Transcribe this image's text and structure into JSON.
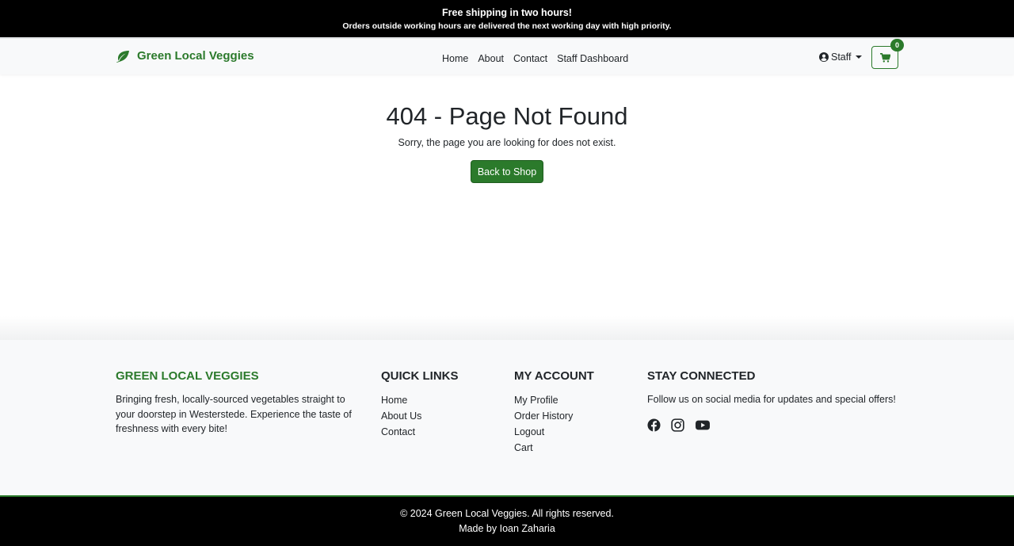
{
  "announcement": {
    "headline": "Free shipping in two hours!",
    "subline": "Orders outside working hours are delivered the next working day with high priority."
  },
  "navbar": {
    "brand": "Green Local Veggies",
    "links": [
      "Home",
      "About",
      "Contact",
      "Staff Dashboard"
    ],
    "user_label": "Staff",
    "cart_count": "0"
  },
  "main": {
    "title": "404 - Page Not Found",
    "message": "Sorry, the page you are looking for does not exist.",
    "button_label": "Back to Shop"
  },
  "footer": {
    "brand_heading": "GREEN LOCAL VEGGIES",
    "brand_text": "Bringing fresh, locally-sourced vegetables straight to your doorstep in Westerstede. Experience the taste of freshness with every bite!",
    "quick_links_heading": "QUICK LINKS",
    "quick_links": [
      "Home",
      "About Us",
      "Contact"
    ],
    "account_heading": "MY ACCOUNT",
    "account_links": [
      "My Profile",
      "Order History",
      "Logout",
      "Cart"
    ],
    "connect_heading": "STAY CONNECTED",
    "connect_text": "Follow us on social media for updates and special offers!",
    "social_icons": [
      "facebook-icon",
      "instagram-icon",
      "youtube-icon"
    ]
  },
  "bottom": {
    "copyright": "© 2024 Green Local Veggies. All rights reserved.",
    "credit": "Made by Ioan Zaharia"
  },
  "colors": {
    "brand_green": "#2b7a2b",
    "dark": "#000000",
    "light_bg": "#f8f9fa"
  }
}
